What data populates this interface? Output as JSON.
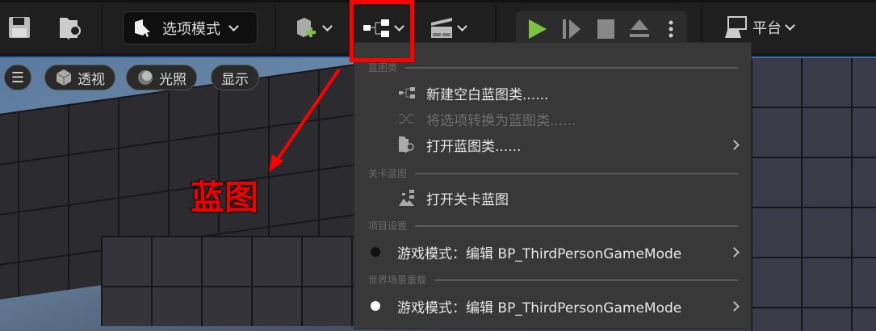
{
  "toolbar": {
    "mode_label": "选项模式",
    "platform_label": "平台",
    "icons": [
      "save-icon",
      "content-browser-icon",
      "select-mode-icon",
      "add-actor-icon",
      "blueprint-icon",
      "cinematics-icon",
      "play-icon",
      "step-icon",
      "stop-icon",
      "eject-icon",
      "more-icon",
      "platform-icon"
    ]
  },
  "viewport": {
    "perspective": "透视",
    "lighting": "光照",
    "show": "显示"
  },
  "annotation": {
    "label": "蓝图",
    "color": "#ff0000"
  },
  "menu": {
    "sections": [
      {
        "title": "蓝图类",
        "items": [
          {
            "label": "新建空白蓝图类......",
            "enabled": true
          },
          {
            "label": "将选项转换为蓝图类......",
            "enabled": false
          },
          {
            "label": "打开蓝图类......",
            "enabled": true,
            "submenu": true
          }
        ]
      },
      {
        "title": "关卡蓝图",
        "items": [
          {
            "label": "打开关卡蓝图",
            "enabled": true
          }
        ]
      },
      {
        "title": "项目设置",
        "items": [
          {
            "label": "游戏模式：编辑 BP_ThirdPersonGameMode",
            "enabled": true,
            "submenu": true
          }
        ]
      },
      {
        "title": "世界场景重载",
        "items": [
          {
            "label": "游戏模式：编辑 BP_ThirdPersonGameMode",
            "enabled": true,
            "submenu": true
          }
        ]
      }
    ]
  },
  "colors": {
    "play": "#7fc241",
    "accent": "#2d6fc0",
    "menu_bg": "#383838"
  }
}
